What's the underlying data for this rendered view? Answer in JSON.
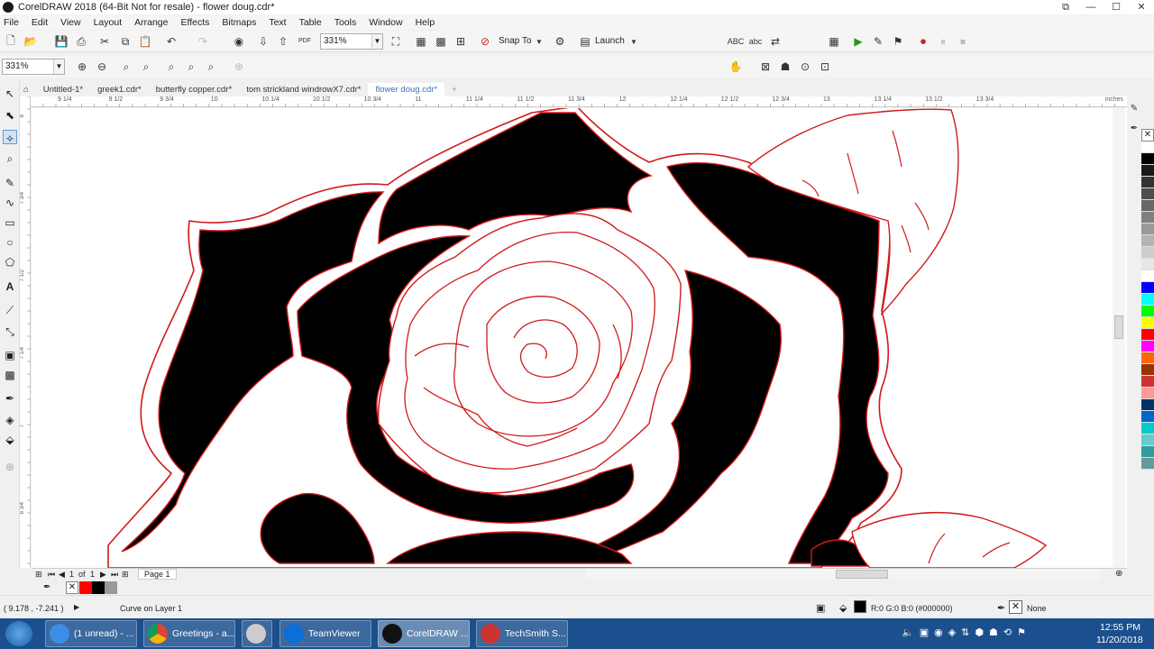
{
  "window": {
    "title": "CorelDRAW 2018 (64-Bit Not for resale) - flower doug.cdr*",
    "controls": [
      "⧉",
      "—",
      "☐",
      "✕"
    ]
  },
  "menu": [
    "File",
    "Edit",
    "View",
    "Layout",
    "Arrange",
    "Effects",
    "Bitmaps",
    "Text",
    "Table",
    "Tools",
    "Window",
    "Help"
  ],
  "toolbar": {
    "zoom_value": "331%",
    "snap_to_label": "Snap To",
    "launch_label": "Launch",
    "pdf_label": "PDF"
  },
  "property_bar": {
    "zoom_value": "331%"
  },
  "document_tabs": [
    "Untitled-1*",
    "greek1.cdr*",
    "butterfly copper.cdr*",
    "tom strickland windrowX7.cdr*",
    "flower doug.cdr*"
  ],
  "active_tab_index": 4,
  "ruler": {
    "labels": [
      "9 1/4",
      "9 1/2",
      "9 3/4",
      "10",
      "10 1/4",
      "10 1/2",
      "10 3/4",
      "11",
      "11 1/4",
      "11 1/2",
      "11 3/4",
      "12",
      "12 1/4",
      "12 1/2",
      "12 3/4",
      "13",
      "13 1/4",
      "13 1/2",
      "13 3/4"
    ],
    "units": "inches",
    "vertical_labels": [
      "8",
      "7 3/4",
      "7 1/2",
      "7 1/4",
      "7",
      "6 3/4"
    ]
  },
  "page_nav": {
    "current": "1",
    "of_label": "of",
    "total": "1",
    "page_tab": "Page 1"
  },
  "status": {
    "coords": "( 9.178 , -7.241 )",
    "object_info": "Curve on Layer 1",
    "fill_info": "R:0 G:0 B:0 (#000000)",
    "outline_info": "None"
  },
  "palette": [
    "#ffffff",
    "#000000",
    "#1a1a1a",
    "#333333",
    "#4d4d4d",
    "#666666",
    "#808080",
    "#999999",
    "#b3b3b3",
    "#cccccc",
    "#e6e6e6",
    "#ffffff",
    "#0000ff",
    "#00ffff",
    "#00ff00",
    "#ffff00",
    "#ff0000",
    "#ff00ff",
    "#ff6600",
    "#993300",
    "#cc3333",
    "#ff9999",
    "#003366",
    "#0066cc",
    "#00cccc",
    "#66cccc",
    "#339999",
    "#669999"
  ],
  "taskbar": {
    "items": [
      "(1 unread) - ...",
      "Greetings - a...",
      "",
      "TeamViewer",
      "CorelDRAW ...",
      "TechSmith S..."
    ],
    "time": "12:55 PM",
    "date": "11/20/2018"
  },
  "colors": {
    "outline_red": "#d11a1a",
    "taskbar_blue": "#1b4f8d",
    "active_tab_text": "#3b6fc0"
  }
}
